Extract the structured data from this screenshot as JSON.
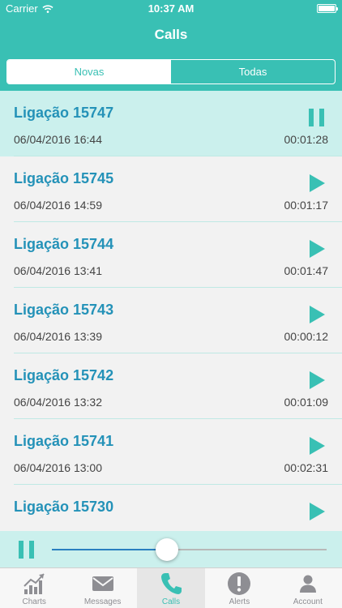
{
  "status_bar": {
    "carrier": "Carrier",
    "time": "10:37 AM"
  },
  "nav": {
    "title": "Calls"
  },
  "segments": [
    {
      "label": "Novas",
      "selected": true
    },
    {
      "label": "Todas",
      "selected": false
    }
  ],
  "calls": [
    {
      "title": "Ligação 15747",
      "date": "06/04/2016 16:44",
      "duration": "00:01:28",
      "state": "playing",
      "icon": "pause-icon"
    },
    {
      "title": "Ligação 15745",
      "date": "06/04/2016 14:59",
      "duration": "00:01:17",
      "state": "stopped",
      "icon": "play-icon"
    },
    {
      "title": "Ligação 15744",
      "date": "06/04/2016 13:41",
      "duration": "00:01:47",
      "state": "stopped",
      "icon": "play-icon"
    },
    {
      "title": "Ligação 15743",
      "date": "06/04/2016 13:39",
      "duration": "00:00:12",
      "state": "stopped",
      "icon": "play-icon"
    },
    {
      "title": "Ligação 15742",
      "date": "06/04/2016 13:32",
      "duration": "00:01:09",
      "state": "stopped",
      "icon": "play-icon"
    },
    {
      "title": "Ligação 15741",
      "date": "06/04/2016 13:00",
      "duration": "00:02:31",
      "state": "stopped",
      "icon": "play-icon"
    },
    {
      "title": "Ligação 15730",
      "date": "",
      "duration": "",
      "state": "stopped",
      "icon": "play-icon"
    }
  ],
  "player": {
    "state": "playing",
    "progress": 0.42
  },
  "tabs": [
    {
      "label": "Charts",
      "icon": "chart-icon",
      "active": false
    },
    {
      "label": "Messages",
      "icon": "envelope-icon",
      "active": false
    },
    {
      "label": "Calls",
      "icon": "phone-icon",
      "active": true
    },
    {
      "label": "Alerts",
      "icon": "alert-icon",
      "active": false
    },
    {
      "label": "Account",
      "icon": "person-icon",
      "active": false
    }
  ],
  "colors": {
    "accent": "#39c0b4",
    "title_blue": "#2492b8",
    "selected_row": "#cbf0ed",
    "slider_fill": "#2a7fc0"
  }
}
